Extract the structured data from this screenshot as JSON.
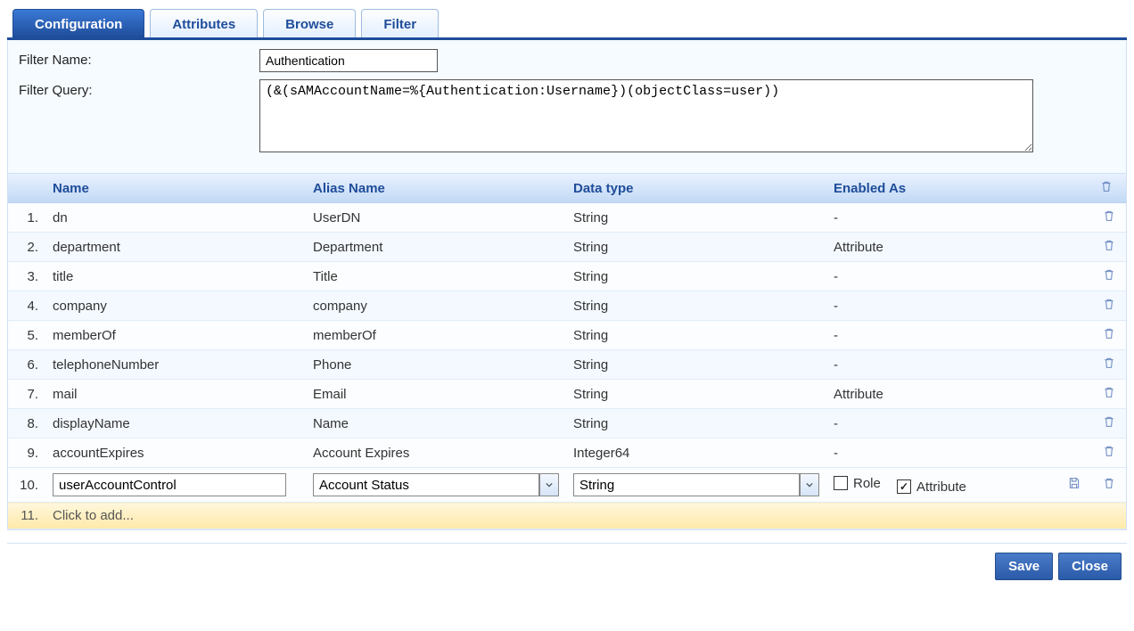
{
  "tabs": [
    {
      "label": "Configuration",
      "active": true
    },
    {
      "label": "Attributes",
      "active": false
    },
    {
      "label": "Browse",
      "active": false
    },
    {
      "label": "Filter",
      "active": false
    }
  ],
  "form": {
    "filter_name_label": "Filter Name:",
    "filter_name_value": "Authentication",
    "filter_query_label": "Filter Query:",
    "filter_query_value": "(&(sAMAccountName=%{Authentication:Username})(objectClass=user))"
  },
  "columns": {
    "idx": "",
    "name": "Name",
    "alias": "Alias Name",
    "type": "Data type",
    "enabled": "Enabled As",
    "action": ""
  },
  "rows": [
    {
      "idx": "1.",
      "name": "dn",
      "alias": "UserDN",
      "type": "String",
      "enabled": "-"
    },
    {
      "idx": "2.",
      "name": "department",
      "alias": "Department",
      "type": "String",
      "enabled": "Attribute"
    },
    {
      "idx": "3.",
      "name": "title",
      "alias": "Title",
      "type": "String",
      "enabled": "-"
    },
    {
      "idx": "4.",
      "name": "company",
      "alias": "company",
      "type": "String",
      "enabled": "-"
    },
    {
      "idx": "5.",
      "name": "memberOf",
      "alias": "memberOf",
      "type": "String",
      "enabled": "-"
    },
    {
      "idx": "6.",
      "name": "telephoneNumber",
      "alias": "Phone",
      "type": "String",
      "enabled": "-"
    },
    {
      "idx": "7.",
      "name": "mail",
      "alias": "Email",
      "type": "String",
      "enabled": "Attribute"
    },
    {
      "idx": "8.",
      "name": "displayName",
      "alias": "Name",
      "type": "String",
      "enabled": "-"
    },
    {
      "idx": "9.",
      "name": "accountExpires",
      "alias": "Account Expires",
      "type": "Integer64",
      "enabled": "-"
    }
  ],
  "edit_row": {
    "idx": "10.",
    "name": "userAccountControl",
    "alias": "Account Status",
    "type": "String",
    "role_label": "Role",
    "role_checked": false,
    "attribute_label": "Attribute",
    "attribute_checked": true
  },
  "add_row": {
    "idx": "11.",
    "text": "Click to add..."
  },
  "buttons": {
    "save": "Save",
    "close": "Close"
  }
}
